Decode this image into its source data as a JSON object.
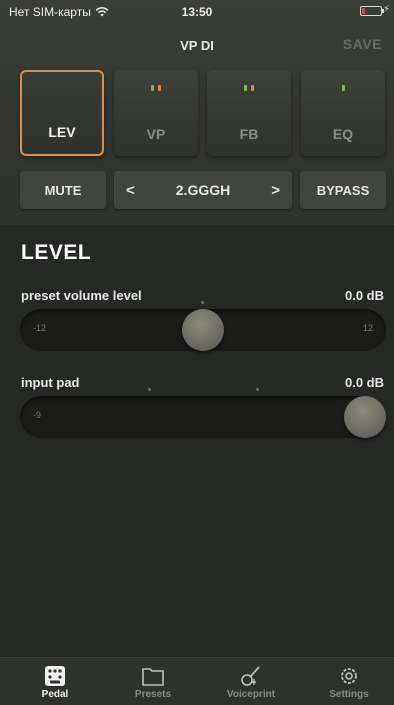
{
  "status_bar": {
    "carrier": "Нет SIM-карты",
    "time": "13:50"
  },
  "nav": {
    "title": "VP DI",
    "save": "SAVE"
  },
  "tiles": [
    {
      "label": "LEV",
      "active": true,
      "leds": []
    },
    {
      "label": "VP",
      "active": false,
      "leds": [
        "#7ac04a",
        "#e08a3a"
      ]
    },
    {
      "label": "FB",
      "active": false,
      "leds": [
        "#7ac04a",
        "#e08a3a"
      ]
    },
    {
      "label": "EQ",
      "active": false,
      "leds": [
        "#7ac04a"
      ]
    }
  ],
  "controls": {
    "mute": "MUTE",
    "preset": "2.GGGH",
    "bypass": "BYPASS",
    "prev": "<",
    "next": ">"
  },
  "section": {
    "title": "LEVEL"
  },
  "params": [
    {
      "label": "preset volume level",
      "value": "0.0 dB",
      "min": "-12",
      "max": "12",
      "position": 0.5
    },
    {
      "label": "input pad",
      "value": "0.0 dB",
      "min": "-9",
      "max": "",
      "position": 1.0
    }
  ],
  "tabs": [
    {
      "label": "Pedal",
      "icon": "pedal-icon",
      "active": true
    },
    {
      "label": "Presets",
      "icon": "folder-icon",
      "active": false
    },
    {
      "label": "Voiceprint",
      "icon": "guitar-icon",
      "active": false
    },
    {
      "label": "Settings",
      "icon": "gear-icon",
      "active": false
    }
  ],
  "colors": {
    "accent": "#d4924a",
    "led_green": "#7ac04a",
    "led_orange": "#e08a3a",
    "battery_low": "#e0453a"
  }
}
